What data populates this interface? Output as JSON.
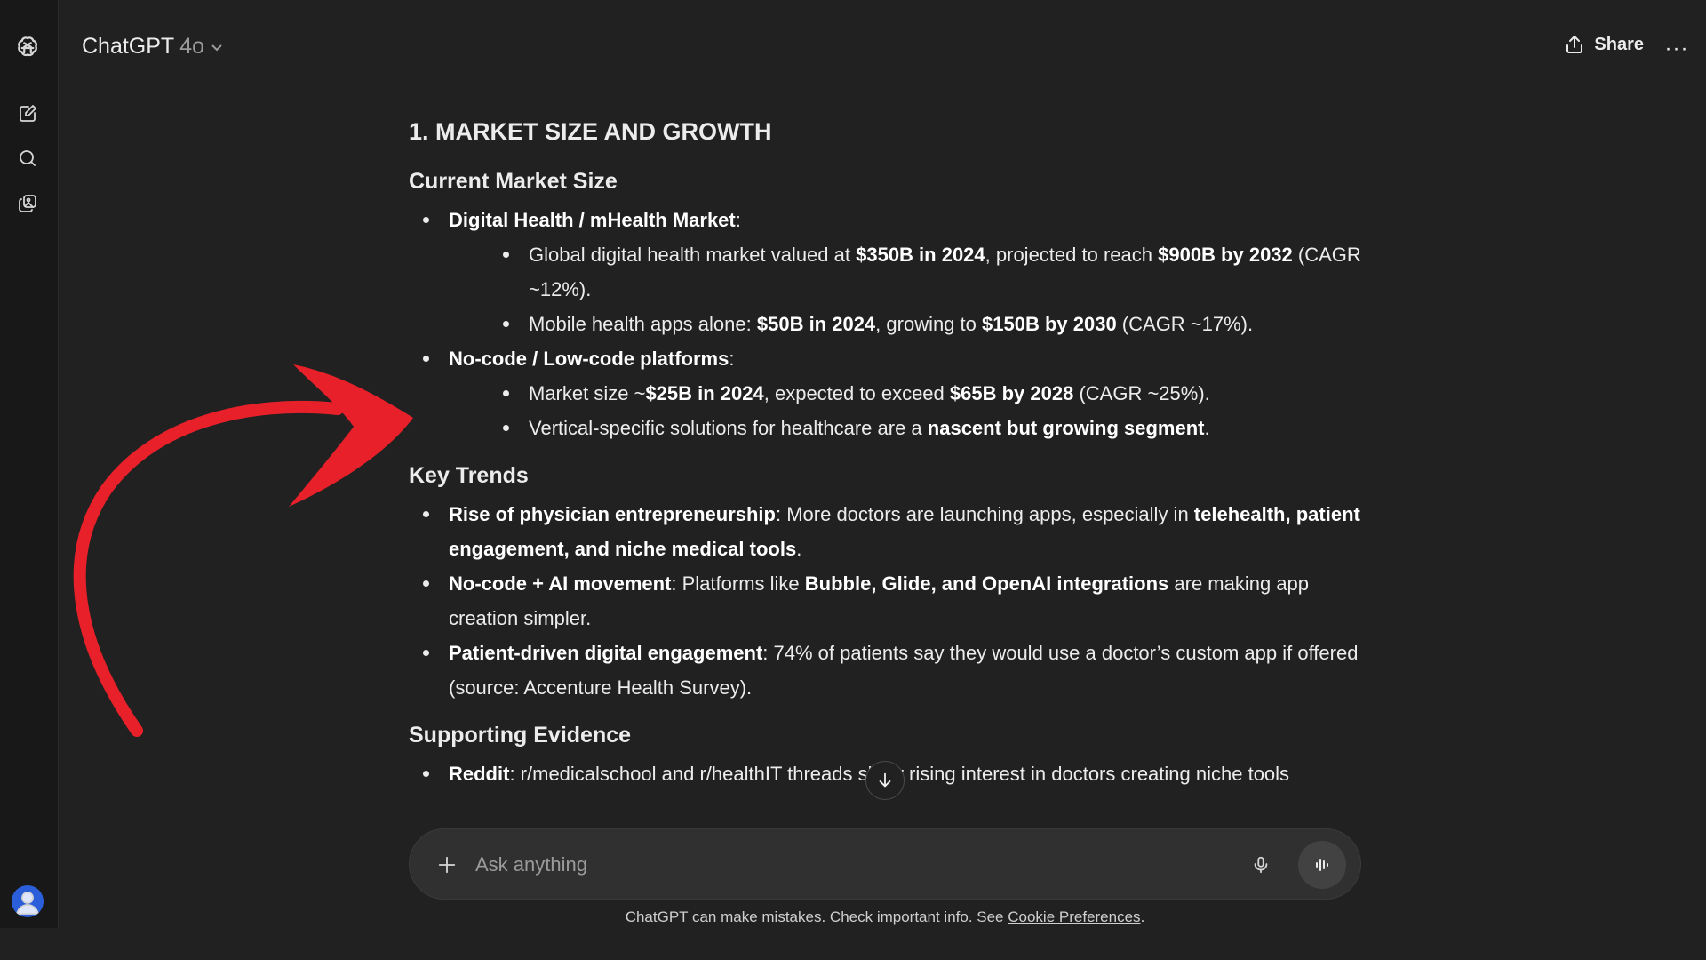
{
  "app": {
    "model_name": "ChatGPT",
    "model_version": "4o",
    "share_label": "Share",
    "more_label": "···"
  },
  "sidebar": {
    "icons": [
      "openai-logo-icon",
      "new-chat-icon",
      "search-icon",
      "library-icon"
    ]
  },
  "content": {
    "heading": "1. MARKET SIZE AND GROWTH",
    "sections": [
      {
        "title": "Current Market Size",
        "items": [
          {
            "parts": [
              {
                "t": "Digital Health / mHealth Market",
                "b": true
              },
              {
                "t": ":"
              }
            ],
            "sub": [
              [
                {
                  "t": "Global digital health market valued at "
                },
                {
                  "t": "$350B in 2024",
                  "b": true
                },
                {
                  "t": ", projected to reach "
                },
                {
                  "t": "$900B by 2032",
                  "b": true
                },
                {
                  "t": " (CAGR ~12%)."
                }
              ],
              [
                {
                  "t": "Mobile health apps alone: "
                },
                {
                  "t": "$50B in 2024",
                  "b": true
                },
                {
                  "t": ", growing to "
                },
                {
                  "t": "$150B by 2030",
                  "b": true
                },
                {
                  "t": " (CAGR ~17%)."
                }
              ]
            ]
          },
          {
            "parts": [
              {
                "t": "No-code / Low-code platforms",
                "b": true
              },
              {
                "t": ":"
              }
            ],
            "sub": [
              [
                {
                  "t": "Market size ~"
                },
                {
                  "t": "$25B in 2024",
                  "b": true
                },
                {
                  "t": ", expected to exceed "
                },
                {
                  "t": "$65B by 2028",
                  "b": true
                },
                {
                  "t": " (CAGR ~25%)."
                }
              ],
              [
                {
                  "t": "Vertical-specific solutions for healthcare are a "
                },
                {
                  "t": "nascent but growing segment",
                  "b": true
                },
                {
                  "t": "."
                }
              ]
            ]
          }
        ]
      },
      {
        "title": "Key Trends",
        "items": [
          {
            "parts": [
              {
                "t": "Rise of physician entrepreneurship",
                "b": true
              },
              {
                "t": ": More doctors are launching apps, especially in "
              },
              {
                "t": "telehealth, patient engagement, and niche medical tools",
                "b": true
              },
              {
                "t": "."
              }
            ]
          },
          {
            "parts": [
              {
                "t": "No-code + AI movement",
                "b": true
              },
              {
                "t": ": Platforms like "
              },
              {
                "t": "Bubble, Glide, and OpenAI integrations",
                "b": true
              },
              {
                "t": " are making app creation simpler."
              }
            ]
          },
          {
            "parts": [
              {
                "t": "Patient-driven digital engagement",
                "b": true
              },
              {
                "t": ": 74% of patients say they would use a doctor’s custom app if offered (source: Accenture Health Survey)."
              }
            ]
          }
        ]
      },
      {
        "title": "Supporting Evidence",
        "items": [
          {
            "parts": [
              {
                "t": "Reddit",
                "b": true
              },
              {
                "t": ": r/medicalschool and r/healthIT threads show rising interest in doctors creating niche tools"
              }
            ]
          }
        ]
      }
    ]
  },
  "composer": {
    "placeholder": "Ask anything"
  },
  "footer": {
    "text": "ChatGPT can make mistakes. Check important info. See ",
    "link": "Cookie Preferences",
    "end": "."
  },
  "colors": {
    "background": "#212121",
    "sidebar": "#181818",
    "annotation_arrow": "#e8202a"
  }
}
